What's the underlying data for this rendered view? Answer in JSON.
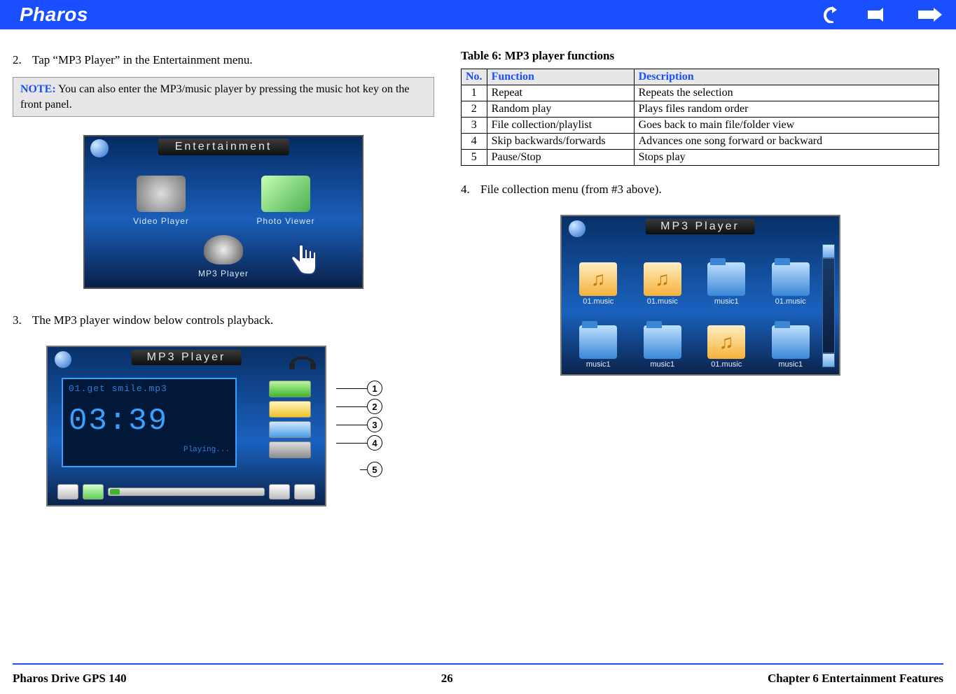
{
  "header": {
    "brand": "Pharos"
  },
  "steps": {
    "s2_num": "2.",
    "s2_text": "Tap “MP3 Player” in the Entertainment menu.",
    "s3_num": "3.",
    "s3_text": "The MP3 player window below controls playback.",
    "s4_num": "4.",
    "s4_text": "File collection menu (from #3 above)."
  },
  "note": {
    "label": "NOTE:",
    "text": " You can also enter the MP3/music player by pressing the music hot key on the front panel."
  },
  "entertainment": {
    "title": "Entertainment",
    "video": "Video Player",
    "photo": "Photo Viewer",
    "mp3": "MP3 Player"
  },
  "mp3_player": {
    "title": "MP3 Player",
    "track": "01.get smile.mp3",
    "time": "03:39",
    "status": "Playing..."
  },
  "callouts": {
    "c1": "1",
    "c2": "2",
    "c3": "3",
    "c4": "4",
    "c5": "5"
  },
  "table": {
    "caption": "Table 6: MP3 player functions",
    "headers": {
      "no": "No.",
      "fn": "Function",
      "desc": "Description"
    },
    "rows": [
      {
        "no": "1",
        "fn": "Repeat",
        "desc": "Repeats the selection"
      },
      {
        "no": "2",
        "fn": "Random play",
        "desc": "Plays files random order"
      },
      {
        "no": "3",
        "fn": "File collection/playlist",
        "desc": "Goes back to main file/folder view"
      },
      {
        "no": "4",
        "fn": "Skip backwards/forwards",
        "desc": "Advances one song forward or backward"
      },
      {
        "no": "5",
        "fn": "Pause/Stop",
        "desc": "Stops play"
      }
    ]
  },
  "file_menu": {
    "title": "MP3 Player",
    "items": [
      {
        "type": "music",
        "label": "01.music"
      },
      {
        "type": "music",
        "label": "01.music"
      },
      {
        "type": "folder",
        "label": "music1"
      },
      {
        "type": "folder",
        "label": "01.music"
      },
      {
        "type": "folder",
        "label": "music1"
      },
      {
        "type": "folder",
        "label": "music1"
      },
      {
        "type": "music",
        "label": "01.music"
      },
      {
        "type": "folder",
        "label": "music1"
      }
    ]
  },
  "footer": {
    "left": "Pharos Drive GPS 140",
    "center": "26",
    "right": "Chapter 6 Entertainment Features"
  }
}
